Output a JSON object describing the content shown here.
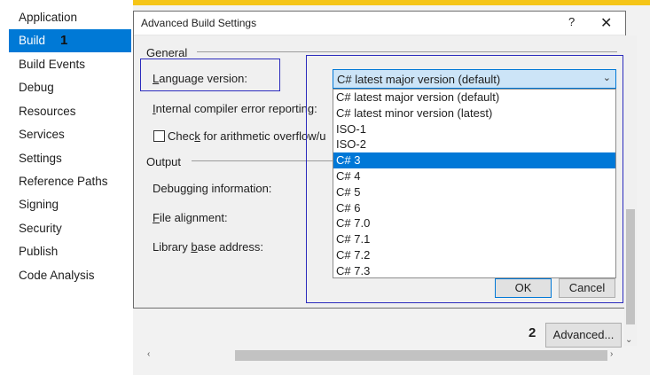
{
  "sidebar": {
    "items": [
      {
        "label": "Application"
      },
      {
        "label": "Build",
        "badge": "1"
      },
      {
        "label": "Build Events"
      },
      {
        "label": "Debug"
      },
      {
        "label": "Resources"
      },
      {
        "label": "Services"
      },
      {
        "label": "Settings"
      },
      {
        "label": "Reference Paths"
      },
      {
        "label": "Signing"
      },
      {
        "label": "Security"
      },
      {
        "label": "Publish"
      },
      {
        "label": "Code Analysis"
      }
    ]
  },
  "dialog": {
    "title": "Advanced Build Settings",
    "help": "?",
    "close": "✕",
    "general_header": "General",
    "language_version_label": "Language version:",
    "ice_label": "Internal compiler error reporting:",
    "overflow_label": "Check for arithmetic overflow/u",
    "output_header": "Output",
    "debug_info_label": "Debugging information:",
    "file_alignment_label": "File alignment:",
    "library_base_label": "Library base address:",
    "ok": "OK",
    "cancel": "Cancel",
    "combo_value": "C# latest major version (default)",
    "options": [
      "C# latest major version (default)",
      "C# latest minor version (latest)",
      "ISO-1",
      "ISO-2",
      "C# 3",
      "C# 4",
      "C# 5",
      "C# 6",
      "C# 7.0",
      "C# 7.1",
      "C# 7.2",
      "C# 7.3"
    ],
    "selected_option": "C# 3"
  },
  "advanced": {
    "badge": "2",
    "label": "Advanced..."
  },
  "colors": {
    "accent": "#0079d6",
    "highlight_box": "#2b2bbd",
    "top_strip": "#f5c518"
  }
}
